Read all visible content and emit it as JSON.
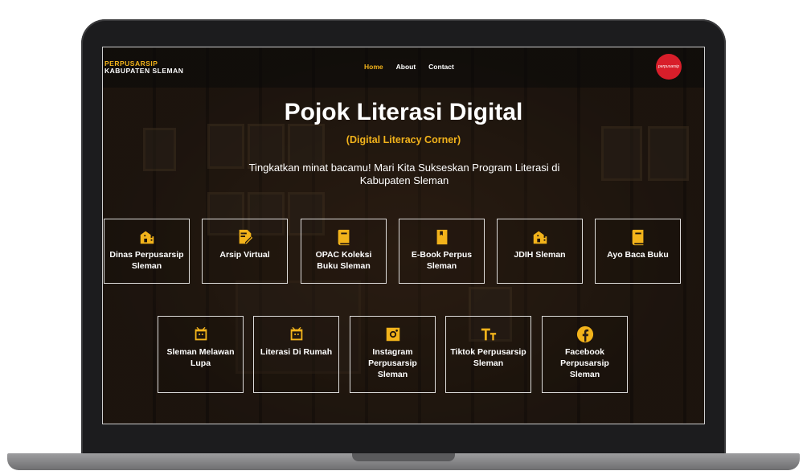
{
  "nav": {
    "brand_line1": "PERPUSARSIP",
    "brand_line2": "KABUPATEN SLEMAN",
    "items": [
      {
        "label": "Home",
        "active": true
      },
      {
        "label": "About",
        "active": false
      },
      {
        "label": "Contact",
        "active": false
      }
    ],
    "logo_text": "perpusarsip"
  },
  "hero": {
    "title": "Pojok Literasi Digital",
    "subtitle": "(Digital Literacy Corner)",
    "description": "Tingkatkan minat bacamu! Mari Kita Sukseskan Program Literasi di Kabupaten Sleman"
  },
  "cards_row1": [
    {
      "label": "Dinas Perpusarsip Sleman",
      "icon": "building-icon"
    },
    {
      "label": "Arsip Virtual",
      "icon": "edit-document-icon"
    },
    {
      "label": "OPAC Koleksi Buku Sleman",
      "icon": "book-icon"
    },
    {
      "label": "E-Book Perpus Sleman",
      "icon": "bookmark-book-icon"
    },
    {
      "label": "JDIH Sleman",
      "icon": "building-icon"
    },
    {
      "label": "Ayo Baca Buku",
      "icon": "book-icon"
    }
  ],
  "cards_row2": [
    {
      "label": "Sleman Melawan Lupa",
      "icon": "tv-robot-icon"
    },
    {
      "label": "Literasi Di Rumah",
      "icon": "tv-robot-icon"
    },
    {
      "label": "Instagram Perpusarsip Sleman",
      "icon": "instagram-icon"
    },
    {
      "label": "Tiktok Perpusarsip Sleman",
      "icon": "text-size-icon"
    },
    {
      "label": "Facebook Perpusarsip Sleman",
      "icon": "facebook-icon"
    }
  ],
  "colors": {
    "accent": "#f2b31b",
    "logo_red": "#d81e2a"
  }
}
